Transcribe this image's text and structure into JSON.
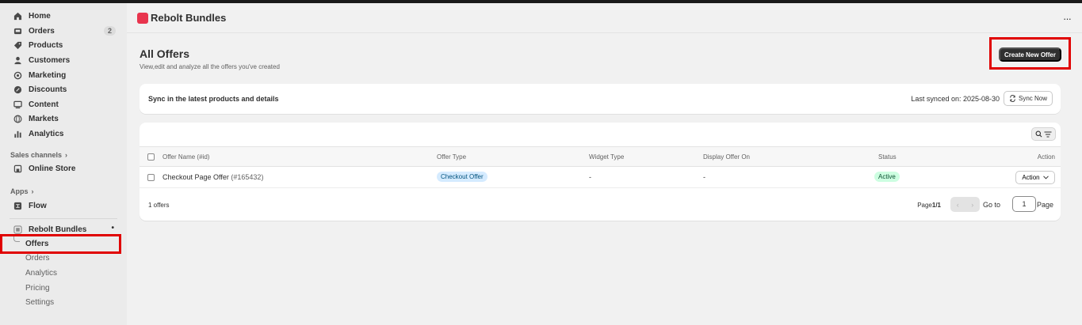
{
  "sidebar": {
    "items": [
      {
        "label": "Home",
        "icon": "home-icon"
      },
      {
        "label": "Orders",
        "icon": "inbox-icon",
        "badge": "2"
      },
      {
        "label": "Products",
        "icon": "tag-icon"
      },
      {
        "label": "Customers",
        "icon": "person-icon"
      },
      {
        "label": "Marketing",
        "icon": "target-icon"
      },
      {
        "label": "Discounts",
        "icon": "discount-icon"
      },
      {
        "label": "Content",
        "icon": "content-icon"
      },
      {
        "label": "Markets",
        "icon": "globe-icon"
      },
      {
        "label": "Analytics",
        "icon": "chart-bar-icon"
      }
    ],
    "sales_channels_label": "Sales channels",
    "online_store_label": "Online Store",
    "apps_label": "Apps",
    "flow_label": "Flow",
    "app_name": "Rebolt Bundles",
    "app_sub_items": [
      "Offers",
      "Orders",
      "Analytics",
      "Pricing",
      "Settings"
    ]
  },
  "header": {
    "title": "Rebolt Bundles",
    "more_label": "···"
  },
  "page": {
    "title": "All Offers",
    "subtitle": "View,edit and analyze all the offers you've created",
    "create_button": "Create New Offer"
  },
  "sync": {
    "text": "Sync in the latest products and details",
    "last_synced": "Last synced on: 2025-08-30",
    "button": "Sync Now"
  },
  "table": {
    "columns": [
      "Offer Name (#id)",
      "Offer Type",
      "Widget Type",
      "Display Offer On",
      "Status",
      "Action"
    ],
    "rows": [
      {
        "name": "Checkout Page Offer",
        "id": "(#165432)",
        "type": "Checkout Offer",
        "widget": "-",
        "display": "-",
        "status": "Active",
        "action": "Action"
      }
    ],
    "count_text": "1 offers",
    "page_prefix": "Page",
    "page_value": "1/1",
    "goto_label": "Go to",
    "page_input": "1",
    "page_suffix": "Page"
  },
  "colors": {
    "highlight": "#e00000",
    "status_active_bg": "#cdfee1",
    "type_pill_bg": "#d5ebff",
    "primary_button": "#303030",
    "app_logo": "#e8344d"
  }
}
